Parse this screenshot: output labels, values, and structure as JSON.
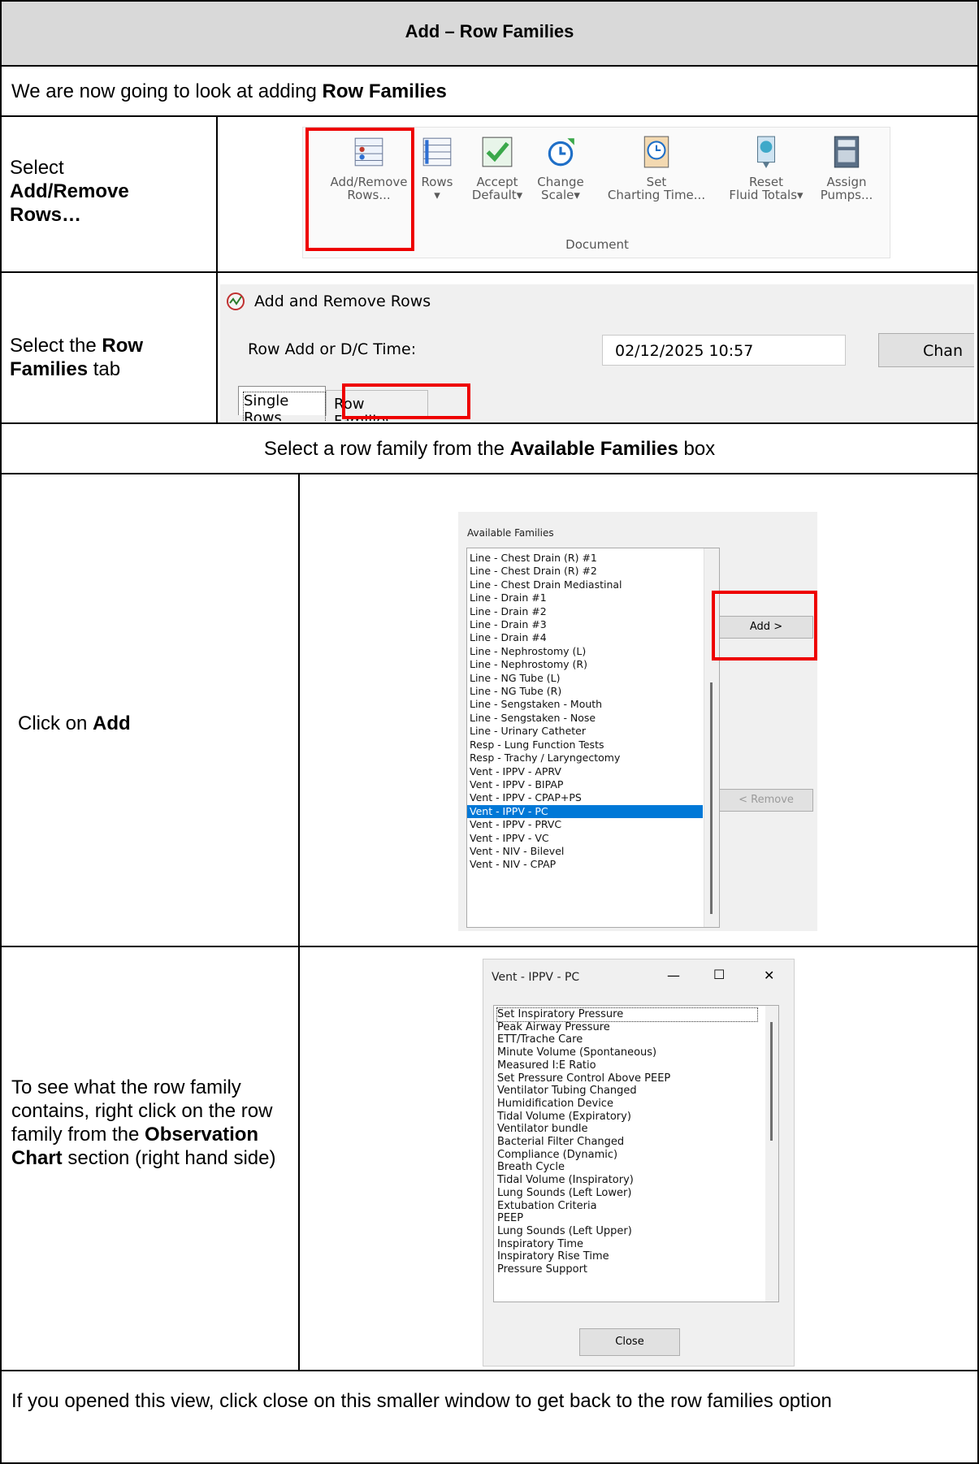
{
  "header": {
    "title": "Add – Row Families"
  },
  "intro": {
    "prefix": "We are now going to look at adding ",
    "bold": "Row Families"
  },
  "step1": {
    "line1": "Select",
    "bold": "Add/Remove Rows…",
    "ribbon": {
      "buttons": [
        {
          "label1": "Add/Remove",
          "label2": "Rows..."
        },
        {
          "label1": "Rows",
          "label2": "▾"
        },
        {
          "label1": "Accept",
          "label2": "Default▾"
        },
        {
          "label1": "Change",
          "label2": "Scale▾"
        },
        {
          "label1": "Set",
          "label2": "Charting Time..."
        },
        {
          "label1": "Reset",
          "label2": "Fluid Totals▾"
        },
        {
          "label1": "Assign",
          "label2": "Pumps..."
        }
      ],
      "group_label": "Document"
    }
  },
  "step2": {
    "prefix": "Select the ",
    "bold": "Row Families",
    "suffix": " tab",
    "dialog": {
      "title": "Add and Remove Rows",
      "time_label": "Row Add or D/C Time:",
      "time_value": "02/12/2025 10:57",
      "change_button": "Chan",
      "tabs": [
        "Single Rows",
        "Row Families"
      ]
    }
  },
  "step3": {
    "prefix": "Select a row family from the ",
    "bold": "Available Families",
    "suffix": " box"
  },
  "step4": {
    "prefix": "Click on ",
    "bold": "Add",
    "available_label": "Available Families",
    "families": [
      "Line - Chest Drain (R) #1",
      "Line - Chest Drain (R) #2",
      "Line - Chest Drain Mediastinal",
      "Line - Drain #1",
      "Line - Drain #2",
      "Line - Drain #3",
      "Line - Drain #4",
      "Line - Nephrostomy (L)",
      "Line - Nephrostomy (R)",
      "Line - NG Tube (L)",
      "Line - NG Tube (R)",
      "Line - Sengstaken - Mouth",
      "Line - Sengstaken - Nose",
      "Line - Urinary Catheter",
      "Resp - Lung Function Tests",
      "Resp - Trachy / Laryngectomy",
      "Vent - IPPV - APRV",
      "Vent - IPPV - BIPAP",
      "Vent - IPPV - CPAP+PS",
      "Vent - IPPV - PC",
      "Vent - IPPV - PRVC",
      "Vent - IPPV - VC",
      "Vent - NIV - Bilevel",
      "Vent - NIV - CPAP"
    ],
    "selected_family": "Vent - IPPV - PC",
    "add_button": "Add >",
    "remove_button": "< Remove"
  },
  "step5": {
    "prefix": "To see what the row family contains, right click on the row family from the ",
    "bold": "Observation Chart",
    "suffix": " section (right hand side)",
    "popup": {
      "title": "Vent - IPPV - PC",
      "minimize": "—",
      "maximize": "☐",
      "close_x": "✕",
      "items": [
        "Set Inspiratory Pressure",
        "Peak Airway Pressure",
        "ETT/Trache Care",
        "Minute Volume (Spontaneous)",
        "Measured I:E Ratio",
        "Set Pressure Control Above PEEP",
        "Ventilator Tubing Changed",
        "Humidification Device",
        "Tidal Volume (Expiratory)",
        "Ventilator bundle",
        "Bacterial Filter Changed",
        "Compliance (Dynamic)",
        "Breath Cycle",
        "Tidal Volume (Inspiratory)",
        "Lung Sounds (Left Lower)",
        "Extubation Criteria",
        "PEEP",
        "Lung Sounds (Left Upper)",
        "Inspiratory Time",
        "Inspiratory Rise Time",
        "Pressure Support"
      ],
      "close_button": "Close"
    }
  },
  "footer": {
    "text": "If you opened this view, click close on this smaller window to get back to the row families option"
  }
}
